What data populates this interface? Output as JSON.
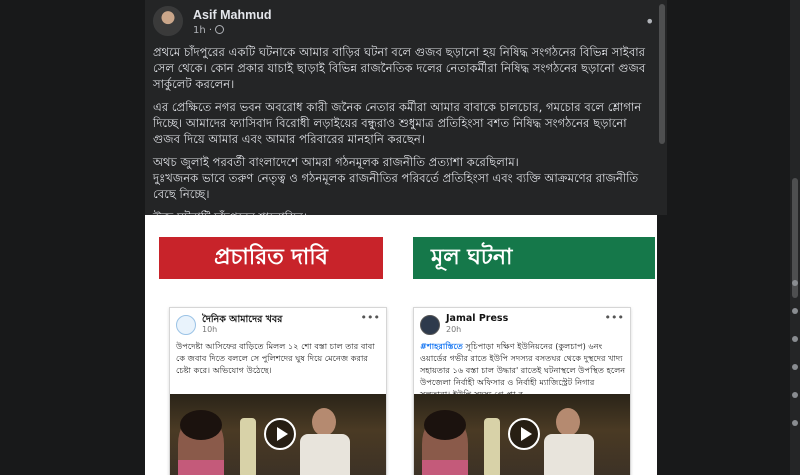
{
  "post": {
    "author": "Asif Mahmud",
    "time": "1h",
    "paragraphs": [
      "প্রথমে চাঁদপুরের একটি ঘটনাকে আমার বাড়ির ঘটনা বলে গুজব ছড়ানো হয় নিষিদ্ধ সংগঠনের বিভিন্ন সাইবার সেল থেকে। কোন প্রকার যাচাই ছাড়াই বিভিন্ন রাজনৈতিক দলের নেতাকর্মীরা নিষিদ্ধ সংগঠনের ছড়ানো গুজব সার্কুলেট করলেন।",
      "এর প্রেক্ষিতে নগর ভবন অবরোধ কারী জনৈক নেতার কর্মীরা আমার বাবাকে চালচোর, গমচোর বলে শ্লোগান দিচ্ছে। আমাদের ফ্যাসিবাদ বিরোধী লড়াইয়ের বন্ধুরাও শুধুমাত্র প্রতিহিংসা বশত নিষিদ্ধ সংগঠনের ছড়ানো গুজব দিয়ে আমার এবং আমার পরিবারের মানহানি করছেন।",
      "অথচ জুলাই পরবর্তী বাংলাদেশে আমরা গঠনমূলক রাজনীতি প্রত্যাশা করেছিলাম।\nদুঃখজনক ভাবে তরুণ নেতৃত্ব ও গঠনমূলক রাজনীতির পরিবর্তে প্রতিহিংসা এবং ব্যক্তি আক্রমণের রাজনীতি বেছে নিচ্ছে।",
      "উক্ত ঘটনাটি চাঁদপুরের শাহরাস্তির।"
    ]
  },
  "image": {
    "banner_left": "প্রচারিত দাবি",
    "banner_right": "মূল ঘটনা",
    "card_left": {
      "name": "দৈনিক আমাদের খবর",
      "time": "10h",
      "text": "উপদেষ্টা আসিফের বাড়িতে মিলল ১২ শো বস্তা চাল তার বাবা কে জবাব দিতে বললে সে পুলিশদের ঘুষ দিয়ে মেনেজ করার চেষ্টা করে। অভিযোগ উঠেছে।"
    },
    "card_right": {
      "name": "Jamal Press",
      "time": "20h",
      "hashtag": "#শাহরাস্তিতে",
      "text": " সূচিপাড়া দক্ষিণ ইউনিয়নের (কুলচাপ) ৬নং ওয়ার্ডের গভীর রাতে ইউপি সদস্যর বসতঘর থেকে দুস্থদের খাদ্য সহায়তার ১৬ বস্তা চাল উদ্ধার' রাতেই ঘটনাস্থলে উপস্থিত হলেন উপজেলা নির্বাহী অফিসার ও নির্বাহী ম্যাজিস্ট্রেট নিগার সুলতানা। ইউপি সদস্য গ্রে-প্তা-র"
    }
  }
}
